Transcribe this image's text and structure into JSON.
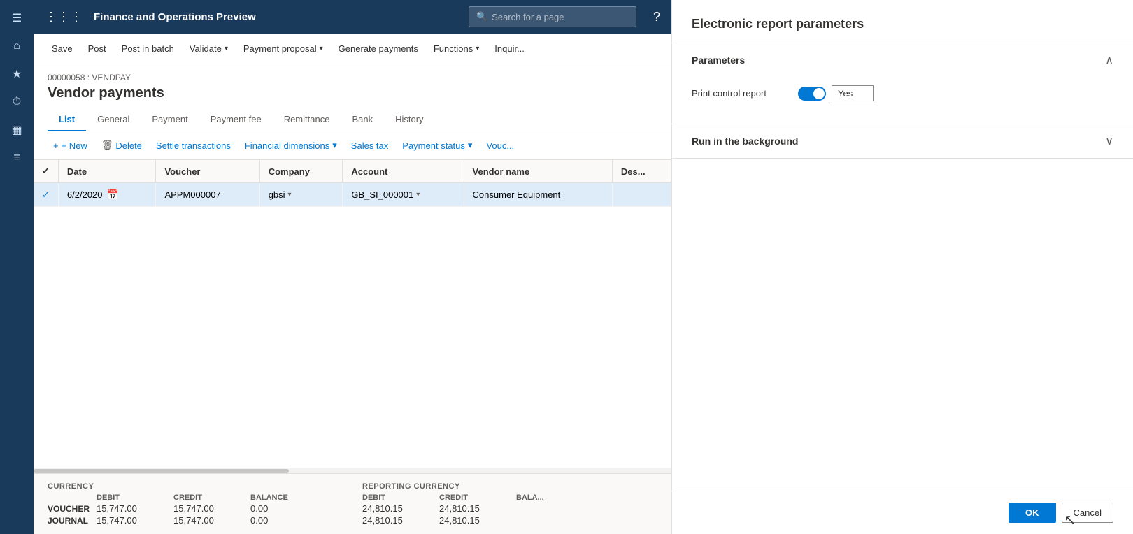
{
  "app": {
    "title": "Finance and Operations Preview",
    "search_placeholder": "Search for a page"
  },
  "toolbar": {
    "save_label": "Save",
    "post_label": "Post",
    "post_batch_label": "Post in batch",
    "validate_label": "Validate",
    "payment_proposal_label": "Payment proposal",
    "generate_payments_label": "Generate payments",
    "functions_label": "Functions",
    "inquire_label": "Inquir..."
  },
  "page": {
    "breadcrumb": "00000058 : VENDPAY",
    "title": "Vendor payments"
  },
  "tabs": [
    {
      "label": "List",
      "active": true
    },
    {
      "label": "General",
      "active": false
    },
    {
      "label": "Payment",
      "active": false
    },
    {
      "label": "Payment fee",
      "active": false
    },
    {
      "label": "Remittance",
      "active": false
    },
    {
      "label": "Bank",
      "active": false
    },
    {
      "label": "History",
      "active": false
    }
  ],
  "sub_toolbar": {
    "new_label": "+ New",
    "delete_label": "Delete",
    "settle_transactions_label": "Settle transactions",
    "financial_dimensions_label": "Financial dimensions",
    "sales_tax_label": "Sales tax",
    "payment_status_label": "Payment status",
    "vouch_label": "Vouc..."
  },
  "table": {
    "columns": [
      "",
      "Date",
      "Voucher",
      "Company",
      "Account",
      "Vendor name",
      "Des..."
    ],
    "rows": [
      {
        "checked": true,
        "date": "6/2/2020",
        "voucher": "APPM000007",
        "company": "gbsi",
        "account": "GB_SI_000001",
        "vendor_name": "Consumer Equipment",
        "description": ""
      }
    ]
  },
  "summary": {
    "currency_label": "CURRENCY",
    "reporting_currency_label": "REPORTING CURRENCY",
    "debit_col": "DEBIT",
    "credit_col": "CREDIT",
    "balance_col": "BALANCE",
    "rows": [
      {
        "label": "VOUCHER",
        "debit": "15,747.00",
        "credit": "15,747.00",
        "balance": "0.00",
        "rep_debit": "24,810.15",
        "rep_credit": "24,810.15"
      },
      {
        "label": "JOURNAL",
        "debit": "15,747.00",
        "credit": "15,747.00",
        "balance": "0.00",
        "rep_debit": "24,810.15",
        "rep_credit": "24,810.15"
      }
    ]
  },
  "right_panel": {
    "title": "Electronic report parameters",
    "parameters_section": {
      "label": "Parameters",
      "fields": [
        {
          "label": "Print control report",
          "toggle_value": "Yes",
          "toggle_on": true
        }
      ]
    },
    "run_background_section": {
      "label": "Run in the background"
    },
    "ok_label": "OK",
    "cancel_label": "Cancel"
  },
  "nav_icons": [
    {
      "name": "grid-icon",
      "glyph": "⋮⋮⋮"
    },
    {
      "name": "home-icon",
      "glyph": "⌂"
    },
    {
      "name": "favorites-icon",
      "glyph": "★"
    },
    {
      "name": "recent-icon",
      "glyph": "⏱"
    },
    {
      "name": "workspaces-icon",
      "glyph": "▦"
    },
    {
      "name": "modules-icon",
      "glyph": "☰"
    }
  ]
}
